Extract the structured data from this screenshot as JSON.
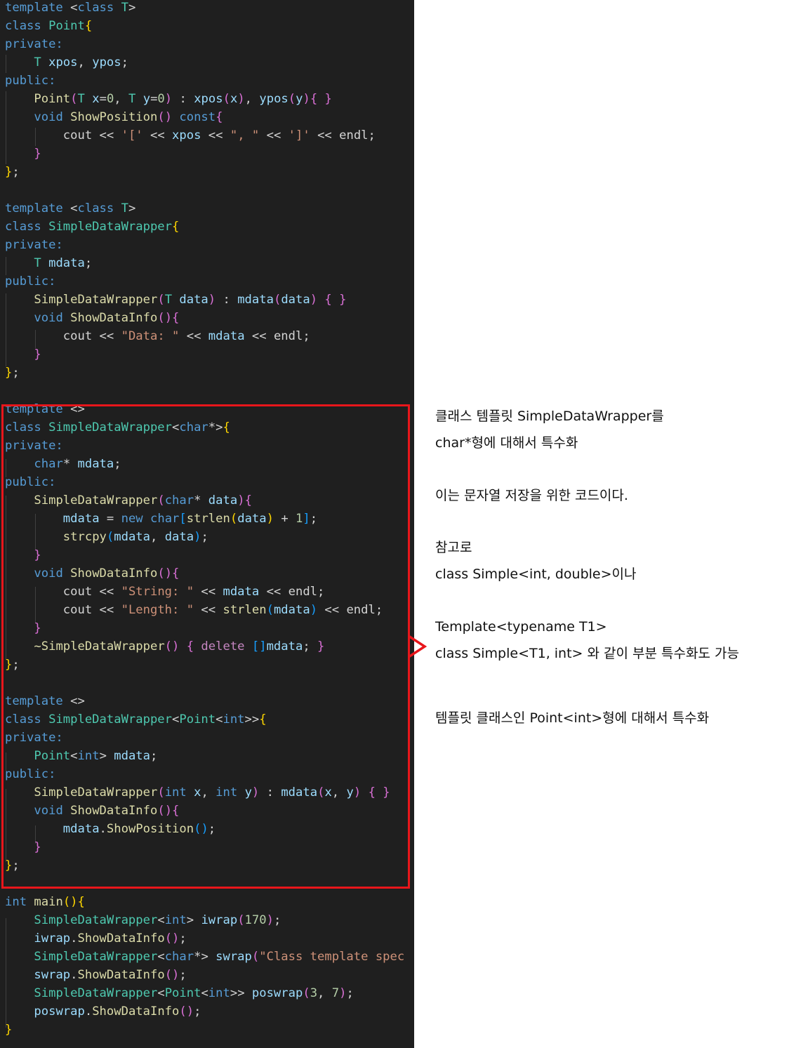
{
  "code_lines": [
    [
      [
        "template ",
        "kw"
      ],
      [
        "<",
        "pl"
      ],
      [
        "class ",
        "kw"
      ],
      [
        "T",
        "type"
      ],
      [
        ">",
        "pl"
      ]
    ],
    [
      [
        "class ",
        "kw"
      ],
      [
        "Point",
        "type"
      ],
      [
        "{",
        "b1"
      ]
    ],
    [
      [
        "private:",
        "kw"
      ]
    ],
    [
      [
        "    ",
        "pl"
      ],
      [
        "T ",
        "type"
      ],
      [
        "xpos",
        "var"
      ],
      [
        ", ",
        "pl"
      ],
      [
        "ypos",
        "var"
      ],
      [
        ";",
        "pl"
      ]
    ],
    [
      [
        "public:",
        "kw"
      ]
    ],
    [
      [
        "    ",
        "pl"
      ],
      [
        "Point",
        "fn"
      ],
      [
        "(",
        "b2"
      ],
      [
        "T ",
        "type"
      ],
      [
        "x",
        "var"
      ],
      [
        "=",
        "pl"
      ],
      [
        "0",
        "num"
      ],
      [
        ", ",
        "pl"
      ],
      [
        "T ",
        "type"
      ],
      [
        "y",
        "var"
      ],
      [
        "=",
        "pl"
      ],
      [
        "0",
        "num"
      ],
      [
        ")",
        "b2"
      ],
      [
        " : ",
        "pl"
      ],
      [
        "xpos",
        "var"
      ],
      [
        "(",
        "b2"
      ],
      [
        "x",
        "var"
      ],
      [
        ")",
        "b2"
      ],
      [
        ", ",
        "pl"
      ],
      [
        "ypos",
        "var"
      ],
      [
        "(",
        "b2"
      ],
      [
        "y",
        "var"
      ],
      [
        ")",
        "b2"
      ],
      [
        "{ }",
        "b2"
      ]
    ],
    [
      [
        "    ",
        "pl"
      ],
      [
        "void ",
        "kw"
      ],
      [
        "ShowPosition",
        "fn"
      ],
      [
        "() ",
        "b2"
      ],
      [
        "const",
        "kw"
      ],
      [
        "{",
        "b2"
      ]
    ],
    [
      [
        "        ",
        "pl"
      ],
      [
        "cout ",
        "pl"
      ],
      [
        "<< ",
        "pl"
      ],
      [
        "'['",
        "str"
      ],
      [
        " << ",
        "pl"
      ],
      [
        "xpos",
        "var"
      ],
      [
        " << ",
        "pl"
      ],
      [
        "\", \"",
        "str"
      ],
      [
        " << ",
        "pl"
      ],
      [
        "']'",
        "str"
      ],
      [
        " << ",
        "pl"
      ],
      [
        "endl",
        "pl"
      ],
      [
        ";",
        "pl"
      ]
    ],
    [
      [
        "    ",
        "pl"
      ],
      [
        "}",
        "b2"
      ]
    ],
    [
      [
        "}",
        "b1"
      ],
      [
        ";",
        "pl"
      ]
    ],
    [],
    [
      [
        "template ",
        "kw"
      ],
      [
        "<",
        "pl"
      ],
      [
        "class ",
        "kw"
      ],
      [
        "T",
        "type"
      ],
      [
        ">",
        "pl"
      ]
    ],
    [
      [
        "class ",
        "kw"
      ],
      [
        "SimpleDataWrapper",
        "type"
      ],
      [
        "{",
        "b1"
      ]
    ],
    [
      [
        "private:",
        "kw"
      ]
    ],
    [
      [
        "    ",
        "pl"
      ],
      [
        "T ",
        "type"
      ],
      [
        "mdata",
        "var"
      ],
      [
        ";",
        "pl"
      ]
    ],
    [
      [
        "public:",
        "kw"
      ]
    ],
    [
      [
        "    ",
        "pl"
      ],
      [
        "SimpleDataWrapper",
        "fn"
      ],
      [
        "(",
        "b2"
      ],
      [
        "T ",
        "type"
      ],
      [
        "data",
        "var"
      ],
      [
        ")",
        "b2"
      ],
      [
        " : ",
        "pl"
      ],
      [
        "mdata",
        "var"
      ],
      [
        "(",
        "b2"
      ],
      [
        "data",
        "var"
      ],
      [
        ")",
        "b2"
      ],
      [
        " { }",
        "b2"
      ]
    ],
    [
      [
        "    ",
        "pl"
      ],
      [
        "void ",
        "kw"
      ],
      [
        "ShowDataInfo",
        "fn"
      ],
      [
        "()",
        "b2"
      ],
      [
        "{",
        "b2"
      ]
    ],
    [
      [
        "        ",
        "pl"
      ],
      [
        "cout ",
        "pl"
      ],
      [
        "<< ",
        "pl"
      ],
      [
        "\"Data: \"",
        "str"
      ],
      [
        " << ",
        "pl"
      ],
      [
        "mdata",
        "var"
      ],
      [
        " << ",
        "pl"
      ],
      [
        "endl",
        "pl"
      ],
      [
        ";",
        "pl"
      ]
    ],
    [
      [
        "    ",
        "pl"
      ],
      [
        "}",
        "b2"
      ]
    ],
    [
      [
        "}",
        "b1"
      ],
      [
        ";",
        "pl"
      ]
    ],
    [],
    [
      [
        "template ",
        "kw"
      ],
      [
        "<>",
        "pl"
      ]
    ],
    [
      [
        "class ",
        "kw"
      ],
      [
        "SimpleDataWrapper",
        "type"
      ],
      [
        "<",
        "pl"
      ],
      [
        "char",
        "kw"
      ],
      [
        "*>",
        "pl"
      ],
      [
        "{",
        "b1"
      ]
    ],
    [
      [
        "private:",
        "kw"
      ]
    ],
    [
      [
        "    ",
        "pl"
      ],
      [
        "char",
        "kw"
      ],
      [
        "* ",
        "pl"
      ],
      [
        "mdata",
        "var"
      ],
      [
        ";",
        "pl"
      ]
    ],
    [
      [
        "public:",
        "kw"
      ]
    ],
    [
      [
        "    ",
        "pl"
      ],
      [
        "SimpleDataWrapper",
        "fn"
      ],
      [
        "(",
        "b2"
      ],
      [
        "char",
        "kw"
      ],
      [
        "* ",
        "pl"
      ],
      [
        "data",
        "var"
      ],
      [
        ")",
        "b2"
      ],
      [
        "{",
        "b2"
      ]
    ],
    [
      [
        "        ",
        "pl"
      ],
      [
        "mdata",
        "var"
      ],
      [
        " = ",
        "pl"
      ],
      [
        "new ",
        "kw"
      ],
      [
        "char",
        "kw"
      ],
      [
        "[",
        "b3"
      ],
      [
        "strlen",
        "fn"
      ],
      [
        "(",
        "b1"
      ],
      [
        "data",
        "var"
      ],
      [
        ")",
        "b1"
      ],
      [
        " + ",
        "pl"
      ],
      [
        "1",
        "num"
      ],
      [
        "]",
        "b3"
      ],
      [
        ";",
        "pl"
      ]
    ],
    [
      [
        "        ",
        "pl"
      ],
      [
        "strcpy",
        "fn"
      ],
      [
        "(",
        "b3"
      ],
      [
        "mdata",
        "var"
      ],
      [
        ", ",
        "pl"
      ],
      [
        "data",
        "var"
      ],
      [
        ")",
        "b3"
      ],
      [
        ";",
        "pl"
      ]
    ],
    [
      [
        "    ",
        "pl"
      ],
      [
        "}",
        "b2"
      ]
    ],
    [
      [
        "    ",
        "pl"
      ],
      [
        "void ",
        "kw"
      ],
      [
        "ShowDataInfo",
        "fn"
      ],
      [
        "()",
        "b2"
      ],
      [
        "{",
        "b2"
      ]
    ],
    [
      [
        "        ",
        "pl"
      ],
      [
        "cout ",
        "pl"
      ],
      [
        "<< ",
        "pl"
      ],
      [
        "\"String: \"",
        "str"
      ],
      [
        " << ",
        "pl"
      ],
      [
        "mdata",
        "var"
      ],
      [
        " << ",
        "pl"
      ],
      [
        "endl",
        "pl"
      ],
      [
        ";",
        "pl"
      ]
    ],
    [
      [
        "        ",
        "pl"
      ],
      [
        "cout ",
        "pl"
      ],
      [
        "<< ",
        "pl"
      ],
      [
        "\"Length: \"",
        "str"
      ],
      [
        " << ",
        "pl"
      ],
      [
        "strlen",
        "fn"
      ],
      [
        "(",
        "b3"
      ],
      [
        "mdata",
        "var"
      ],
      [
        ")",
        "b3"
      ],
      [
        " << ",
        "pl"
      ],
      [
        "endl",
        "pl"
      ],
      [
        ";",
        "pl"
      ]
    ],
    [
      [
        "    ",
        "pl"
      ],
      [
        "}",
        "b2"
      ]
    ],
    [
      [
        "    ",
        "pl"
      ],
      [
        "~SimpleDataWrapper",
        "fn"
      ],
      [
        "()",
        "b2"
      ],
      [
        " { ",
        "b2"
      ],
      [
        "delete ",
        "kwc"
      ],
      [
        "[]",
        "b3"
      ],
      [
        "mdata",
        "var"
      ],
      [
        "; ",
        "pl"
      ],
      [
        "}",
        "b2"
      ]
    ],
    [
      [
        "}",
        "b1"
      ],
      [
        ";",
        "pl"
      ]
    ],
    [],
    [
      [
        "template ",
        "kw"
      ],
      [
        "<>",
        "pl"
      ]
    ],
    [
      [
        "class ",
        "kw"
      ],
      [
        "SimpleDataWrapper",
        "type"
      ],
      [
        "<",
        "pl"
      ],
      [
        "Point",
        "type"
      ],
      [
        "<",
        "pl"
      ],
      [
        "int",
        "kw"
      ],
      [
        ">>",
        "pl"
      ],
      [
        "{",
        "b1"
      ]
    ],
    [
      [
        "private:",
        "kw"
      ]
    ],
    [
      [
        "    ",
        "pl"
      ],
      [
        "Point",
        "type"
      ],
      [
        "<",
        "pl"
      ],
      [
        "int",
        "kw"
      ],
      [
        "> ",
        "pl"
      ],
      [
        "mdata",
        "var"
      ],
      [
        ";",
        "pl"
      ]
    ],
    [
      [
        "public:",
        "kw"
      ]
    ],
    [
      [
        "    ",
        "pl"
      ],
      [
        "SimpleDataWrapper",
        "fn"
      ],
      [
        "(",
        "b2"
      ],
      [
        "int ",
        "kw"
      ],
      [
        "x",
        "var"
      ],
      [
        ", ",
        "pl"
      ],
      [
        "int ",
        "kw"
      ],
      [
        "y",
        "var"
      ],
      [
        ")",
        "b2"
      ],
      [
        " : ",
        "pl"
      ],
      [
        "mdata",
        "var"
      ],
      [
        "(",
        "b2"
      ],
      [
        "x",
        "var"
      ],
      [
        ", ",
        "pl"
      ],
      [
        "y",
        "var"
      ],
      [
        ")",
        "b2"
      ],
      [
        " { }",
        "b2"
      ]
    ],
    [
      [
        "    ",
        "pl"
      ],
      [
        "void ",
        "kw"
      ],
      [
        "ShowDataInfo",
        "fn"
      ],
      [
        "()",
        "b2"
      ],
      [
        "{",
        "b2"
      ]
    ],
    [
      [
        "        ",
        "pl"
      ],
      [
        "mdata",
        "var"
      ],
      [
        ".",
        "pl"
      ],
      [
        "ShowPosition",
        "fn"
      ],
      [
        "()",
        "b3"
      ],
      [
        ";",
        "pl"
      ]
    ],
    [
      [
        "    ",
        "pl"
      ],
      [
        "}",
        "b2"
      ]
    ],
    [
      [
        "}",
        "b1"
      ],
      [
        ";",
        "pl"
      ]
    ],
    [],
    [
      [
        "int ",
        "kw"
      ],
      [
        "main",
        "fn"
      ],
      [
        "()",
        "b1"
      ],
      [
        "{",
        "b1"
      ]
    ],
    [
      [
        "    ",
        "pl"
      ],
      [
        "SimpleDataWrapper",
        "type"
      ],
      [
        "<",
        "pl"
      ],
      [
        "int",
        "kw"
      ],
      [
        "> ",
        "pl"
      ],
      [
        "iwrap",
        "var"
      ],
      [
        "(",
        "b2"
      ],
      [
        "170",
        "num"
      ],
      [
        ")",
        "b2"
      ],
      [
        ";",
        "pl"
      ]
    ],
    [
      [
        "    ",
        "pl"
      ],
      [
        "iwrap",
        "var"
      ],
      [
        ".",
        "pl"
      ],
      [
        "ShowDataInfo",
        "fn"
      ],
      [
        "()",
        "b2"
      ],
      [
        ";",
        "pl"
      ]
    ],
    [
      [
        "    ",
        "pl"
      ],
      [
        "SimpleDataWrapper",
        "type"
      ],
      [
        "<",
        "pl"
      ],
      [
        "char",
        "kw"
      ],
      [
        "*> ",
        "pl"
      ],
      [
        "swrap",
        "var"
      ],
      [
        "(",
        "b2"
      ],
      [
        "\"Class template spec",
        "str"
      ]
    ],
    [
      [
        "    ",
        "pl"
      ],
      [
        "swrap",
        "var"
      ],
      [
        ".",
        "pl"
      ],
      [
        "ShowDataInfo",
        "fn"
      ],
      [
        "()",
        "b2"
      ],
      [
        ";",
        "pl"
      ]
    ],
    [
      [
        "    ",
        "pl"
      ],
      [
        "SimpleDataWrapper",
        "type"
      ],
      [
        "<",
        "pl"
      ],
      [
        "Point",
        "type"
      ],
      [
        "<",
        "pl"
      ],
      [
        "int",
        "kw"
      ],
      [
        ">> ",
        "pl"
      ],
      [
        "poswrap",
        "var"
      ],
      [
        "(",
        "b2"
      ],
      [
        "3",
        "num"
      ],
      [
        ", ",
        "pl"
      ],
      [
        "7",
        "num"
      ],
      [
        ")",
        "b2"
      ],
      [
        ";",
        "pl"
      ]
    ],
    [
      [
        "    ",
        "pl"
      ],
      [
        "poswrap",
        "var"
      ],
      [
        ".",
        "pl"
      ],
      [
        "ShowDataInfo",
        "fn"
      ],
      [
        "()",
        "b2"
      ],
      [
        ";",
        "pl"
      ]
    ],
    [
      [
        "}",
        "b1"
      ]
    ]
  ],
  "annotations": {
    "line1": "클래스 템플릿 SimpleDataWrapper를",
    "line2": "char*형에 대해서 특수화",
    "line3": "이는 문자열 저장을 위한 코드이다.",
    "line4": "참고로",
    "line5": "class Simple<int, double>이나",
    "line6": "Template<typename T1>",
    "line7": "class Simple<T1, int> 와 같이 부분 특수화도 가능",
    "line8": "템플릿 클래스인 Point<int>형에 대해서 특수화"
  },
  "colors": {
    "editor_bg": "#1f1f1f",
    "highlight_border": "#e8161b"
  }
}
